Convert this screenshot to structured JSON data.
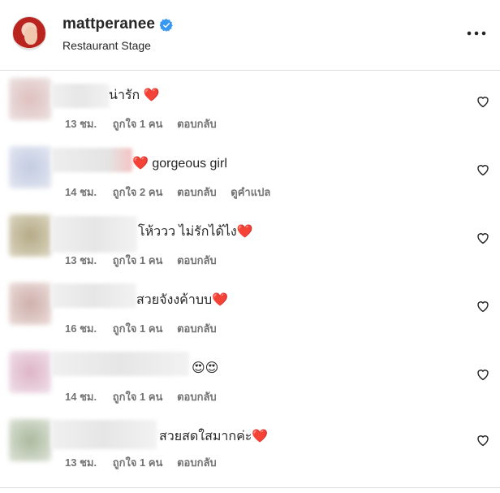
{
  "header": {
    "username": "mattperanee",
    "subtitle": "Restaurant Stage",
    "more_icon": "more-horizontal-icon"
  },
  "comments": [
    {
      "text": "น่ารัก ❤️",
      "time": "13 ชม.",
      "likes": "ถูกใจ 1 คน",
      "reply": "ตอบกลับ"
    },
    {
      "text": "❤️ gorgeous girl",
      "time": "14 ชม.",
      "likes": "ถูกใจ 2 คน",
      "reply": "ตอบกลับ",
      "translate": "ดูคำแปล"
    },
    {
      "text": "โห้ววว ไม่รักได้ไง❤️",
      "time": "13 ชม.",
      "likes": "ถูกใจ 1 คน",
      "reply": "ตอบกลับ"
    },
    {
      "text": "สวยจังงค้าบบ❤️",
      "time": "16 ชม.",
      "likes": "ถูกใจ 1 คน",
      "reply": "ตอบกลับ"
    },
    {
      "text": "😍😍",
      "time": "14 ชม.",
      "likes": "ถูกใจ 1 คน",
      "reply": "ตอบกลับ"
    },
    {
      "text": "สวยสดใสมากค่ะ❤️",
      "time": "13 ชม.",
      "likes": "ถูกใจ 1 คน",
      "reply": "ตอบกลับ"
    }
  ],
  "colors": {
    "text": "#262626",
    "meta": "#737373",
    "heart": "#e0233a",
    "verified": "#3897f0",
    "divider": "#dbdbdb"
  }
}
